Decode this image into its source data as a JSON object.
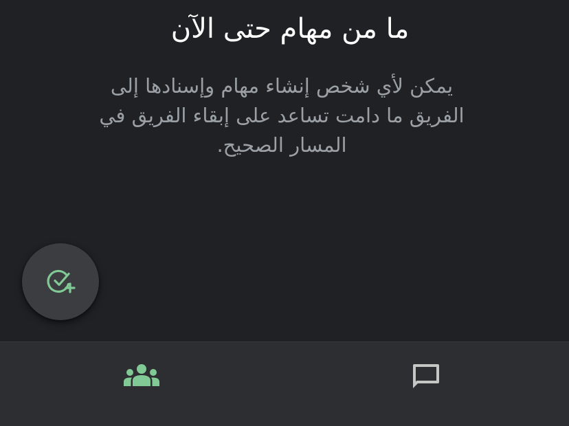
{
  "empty_state": {
    "title": "ما من مهام حتى الآن",
    "description": "يمكن لأي شخص إنشاء مهام وإسنادها إلى الفريق ما دامت تساعد على إبقاء الفريق في المسار الصحيح."
  },
  "fab": {
    "icon": "add-task-icon"
  },
  "bottom_nav": {
    "items": [
      {
        "icon": "people-icon",
        "active": true
      },
      {
        "icon": "chat-icon",
        "active": false
      }
    ]
  },
  "colors": {
    "background": "#202124",
    "nav_background": "#2d2e31",
    "fab_background": "#3c3d40",
    "accent": "#81c995",
    "title_text": "#ffffff",
    "secondary_text": "#9aa0a6",
    "icon_inactive": "#c4c7c5"
  }
}
